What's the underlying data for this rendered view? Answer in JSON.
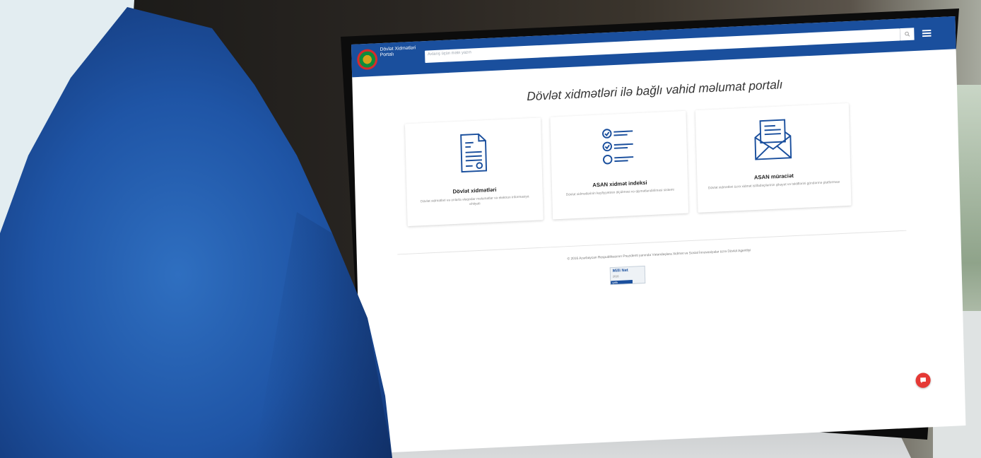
{
  "header": {
    "logo_text": "Dövlət Xidmətləri Portalı",
    "search_placeholder": "Axtarış üçün mətn yazın",
    "search_icon": "search-icon",
    "menu_icon": "menu-icon"
  },
  "main": {
    "title": "Dövlət xidmətləri ilə bağlı vahid məlumat portalı",
    "cards": [
      {
        "title": "Dövlət xidmətləri",
        "desc": "Dövlət xidmətləri və onlarla əlaqədar məlumatlar və elektron informasiya ehtiyatı",
        "icon": "document-icon"
      },
      {
        "title": "ASAN xidmət indeksi",
        "desc": "Dövlət xidmətlərinin keyfiyyətinin ölçülməsi və qiymətləndirilməsi sistemi",
        "icon": "checklist-icon"
      },
      {
        "title": "ASAN müraciət",
        "desc": "Dövlət xidmətləri üzrə xidmət istifadəçilərinin şikayət və təkliflərini göndərmə platforması",
        "icon": "envelope-icon"
      }
    ]
  },
  "footer": {
    "copyright": "© 2016 Azərbaycan Respublikasının Prezidenti yanında Vətəndaşlara Xidmət və Sosial İnnovasiyalar üzrə Dövlət Agentliyi",
    "badge_title": "Milli Net",
    "badge_year": "2016",
    "badge_sub": "qalib"
  },
  "chat": {
    "icon": "chat-icon"
  },
  "colors": {
    "brand": "#1a4f9d",
    "accent": "#e53935"
  }
}
